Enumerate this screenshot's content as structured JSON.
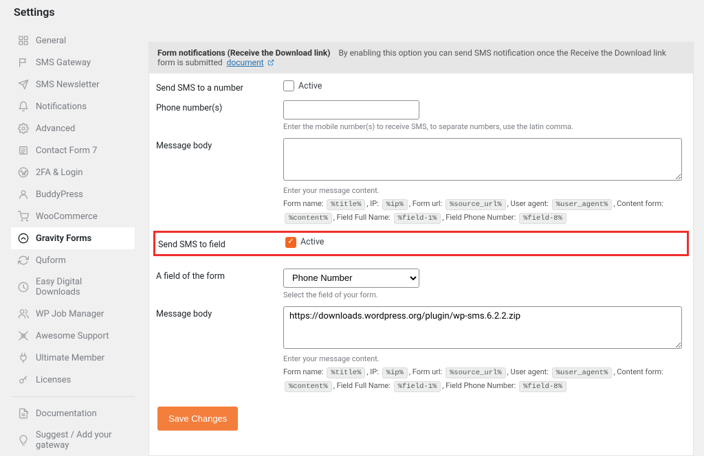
{
  "page_title": "Settings",
  "sidebar": {
    "items": [
      {
        "label": "General",
        "icon": "general"
      },
      {
        "label": "SMS Gateway",
        "icon": "flag"
      },
      {
        "label": "SMS Newsletter",
        "icon": "send"
      },
      {
        "label": "Notifications",
        "icon": "bell"
      },
      {
        "label": "Advanced",
        "icon": "gear"
      },
      {
        "label": "Contact Form 7",
        "icon": "form"
      },
      {
        "label": "2FA & Login",
        "icon": "wp"
      },
      {
        "label": "BuddyPress",
        "icon": "buddy"
      },
      {
        "label": "WooCommerce",
        "icon": "cart"
      },
      {
        "label": "Gravity Forms",
        "icon": "gravity",
        "active": true
      },
      {
        "label": "Quform",
        "icon": "refresh"
      },
      {
        "label": "Easy Digital Downloads",
        "icon": "edd"
      },
      {
        "label": "WP Job Manager",
        "icon": "job"
      },
      {
        "label": "Awesome Support",
        "icon": "support"
      },
      {
        "label": "Ultimate Member",
        "icon": "plug"
      },
      {
        "label": "Licenses",
        "icon": "key"
      }
    ],
    "bottom": [
      {
        "label": "Documentation",
        "icon": "doc"
      },
      {
        "label": "Suggest / Add your gateway",
        "icon": "bulb"
      }
    ]
  },
  "section_header": {
    "title": "Form notifications (Receive the Download link)",
    "desc": "By enabling this option you can send SMS notification once the Receive the Download link form is submitted",
    "link": "document"
  },
  "rows": {
    "send_to_number_label": "Send SMS to a number",
    "phone_label": "Phone number(s)",
    "phone_hint": "Enter the mobile number(s) to receive SMS, to separate numbers, use the latin comma.",
    "msg1_label": "Message body",
    "msg1_hint": "Enter your message content.",
    "send_to_field_label": "Send SMS to field",
    "field_label": "A field of the form",
    "field_selected": "Phone Number",
    "field_hint": "Select the field of your form.",
    "msg2_label": "Message body",
    "msg2_value": "https://downloads.wordpress.org/plugin/wp-sms.6.2.2.zip",
    "msg2_hint": "Enter your message content.",
    "active_label": "Active",
    "active1_checked": false,
    "active2_checked": true
  },
  "placeholders": {
    "form_name": "Form name:",
    "form_name_tag": "%title%",
    "ip": "IP:",
    "ip_tag": "%ip%",
    "form_url": "Form url:",
    "form_url_tag": "%source_url%",
    "user_agent": "User agent:",
    "user_agent_tag": "%user_agent%",
    "content_form": "Content form:",
    "content_form_tag": "%content%",
    "field_full_name": "Field Full Name:",
    "field_full_name_tag": "%field-1%",
    "field_phone": "Field Phone Number:",
    "field_phone_tag": "%field-8%"
  },
  "save_button": "Save Changes"
}
